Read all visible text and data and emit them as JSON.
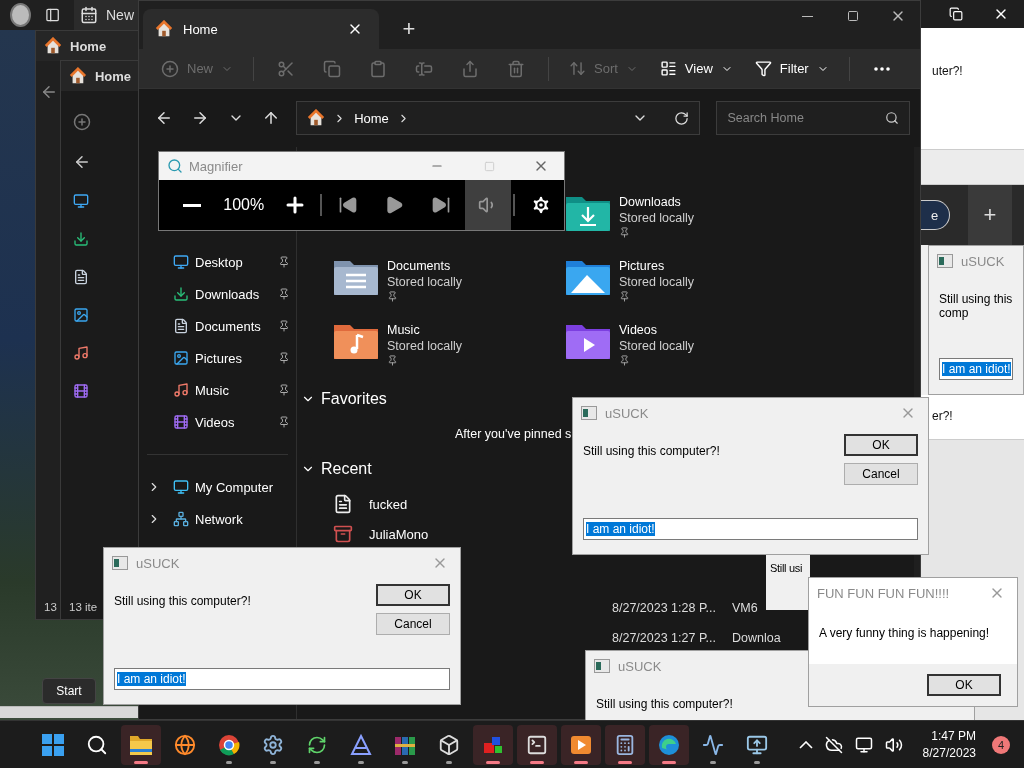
{
  "browser_fragment": {
    "tab_title": "New"
  },
  "back_windows": [
    {
      "title": "Home",
      "status": "13"
    },
    {
      "title": "Home",
      "status": "13 ite"
    }
  ],
  "start_tooltip": "Start",
  "right_fragments": {
    "top_text": "uter?!",
    "browser_button": "e",
    "new_tab": "+",
    "lower_text": "er?!"
  },
  "behind_dialog_text": "Still usi",
  "explorer": {
    "tab": "Home",
    "new_tab": "+",
    "command_bar": {
      "new": {
        "label": "New",
        "disabled": true
      },
      "actions_disabled": true,
      "sort": {
        "label": "Sort",
        "disabled": true
      },
      "view": {
        "label": "View",
        "disabled": false
      },
      "filter": {
        "label": "Filter",
        "disabled": false
      }
    },
    "address": {
      "crumbs": [
        "Home"
      ]
    },
    "search": {
      "placeholder": "Search Home"
    },
    "sidebar": {
      "pinned": [
        {
          "kind": "desktop",
          "label": "Desktop"
        },
        {
          "kind": "downloads",
          "label": "Downloads"
        },
        {
          "kind": "documents",
          "label": "Documents"
        },
        {
          "kind": "pictures",
          "label": "Pictures"
        },
        {
          "kind": "music",
          "label": "Music"
        },
        {
          "kind": "videos",
          "label": "Videos"
        }
      ],
      "locations": [
        {
          "kind": "computer",
          "label": "My Computer",
          "expanded": false
        },
        {
          "kind": "network",
          "label": "Network",
          "expanded": false
        }
      ]
    },
    "quick_access": [
      {
        "kind": "downloads",
        "name": "Downloads",
        "status": "Stored locally",
        "pinned": true
      },
      {
        "kind": "documents",
        "name": "Documents",
        "status": "Stored locally",
        "pinned": true
      },
      {
        "kind": "pictures",
        "name": "Pictures",
        "status": "Stored locally",
        "pinned": true
      },
      {
        "kind": "music",
        "name": "Music",
        "status": "Stored locally",
        "pinned": true
      },
      {
        "kind": "videos",
        "name": "Videos",
        "status": "Stored locally",
        "pinned": true
      }
    ],
    "favorites": {
      "title": "Favorites",
      "expanded": true,
      "empty_text": "After you've pinned s"
    },
    "recent": {
      "title": "Recent",
      "expanded": true,
      "items": [
        {
          "kind": "text",
          "name": "fucked"
        },
        {
          "kind": "archive",
          "name": "JuliaMono"
        }
      ],
      "rows": [
        {
          "modified": "8/27/2023 1:28 P...",
          "location": "VM6"
        },
        {
          "modified": "8/27/2023 1:27 P...",
          "location": "Downloa"
        }
      ]
    }
  },
  "magnifier": {
    "title": "Magnifier",
    "zoom": "100%",
    "read_mode_selected": true
  },
  "dialogs": [
    {
      "kind": "prompt",
      "title": "uSUCK",
      "message": "Still using this comp",
      "input": "I am an idiot!"
    },
    {
      "kind": "prompt",
      "title": "uSUCK",
      "message": "Still using this computer?!"
    },
    {
      "kind": "alert",
      "title": "FUN FUN FUN FUN!!!!",
      "message": "A very funny thing is happening!",
      "buttons": [
        "OK"
      ]
    },
    {
      "kind": "prompt",
      "title": "uSUCK",
      "message": "Still using this computer?!",
      "buttons": [
        "OK",
        "Cancel"
      ],
      "input": "I am an idiot!"
    },
    {
      "kind": "prompt",
      "title": "uSUCK",
      "message": "Still using this computer?!",
      "buttons": [
        "OK",
        "Cancel"
      ],
      "input": "I am an idiot!"
    }
  ],
  "taskbar": {
    "apps": [
      {
        "kind": "start",
        "open": false,
        "flashing": false
      },
      {
        "kind": "search",
        "open": false,
        "flashing": false
      },
      {
        "kind": "explorer",
        "open": true,
        "flashing": true
      },
      {
        "kind": "globe",
        "open": false,
        "flashing": false
      },
      {
        "kind": "wheel",
        "open": true,
        "flashing": false
      },
      {
        "kind": "gear",
        "open": true,
        "flashing": false
      },
      {
        "kind": "sync",
        "open": true,
        "flashing": false
      },
      {
        "kind": "triangle",
        "open": true,
        "flashing": false
      },
      {
        "kind": "books",
        "open": true,
        "flashing": false
      },
      {
        "kind": "cube",
        "open": true,
        "flashing": false
      },
      {
        "kind": "blocks",
        "open": true,
        "flashing": true
      },
      {
        "kind": "terminal",
        "open": true,
        "flashing": true
      },
      {
        "kind": "player",
        "open": true,
        "flashing": true
      },
      {
        "kind": "calculator",
        "open": true,
        "flashing": true
      },
      {
        "kind": "swirl",
        "open": true,
        "flashing": true
      },
      {
        "kind": "chart",
        "open": true,
        "flashing": false
      },
      {
        "kind": "remote",
        "open": true,
        "flashing": false
      }
    ],
    "time": "1:47 PM",
    "date": "8/27/2023",
    "badge": "4"
  }
}
